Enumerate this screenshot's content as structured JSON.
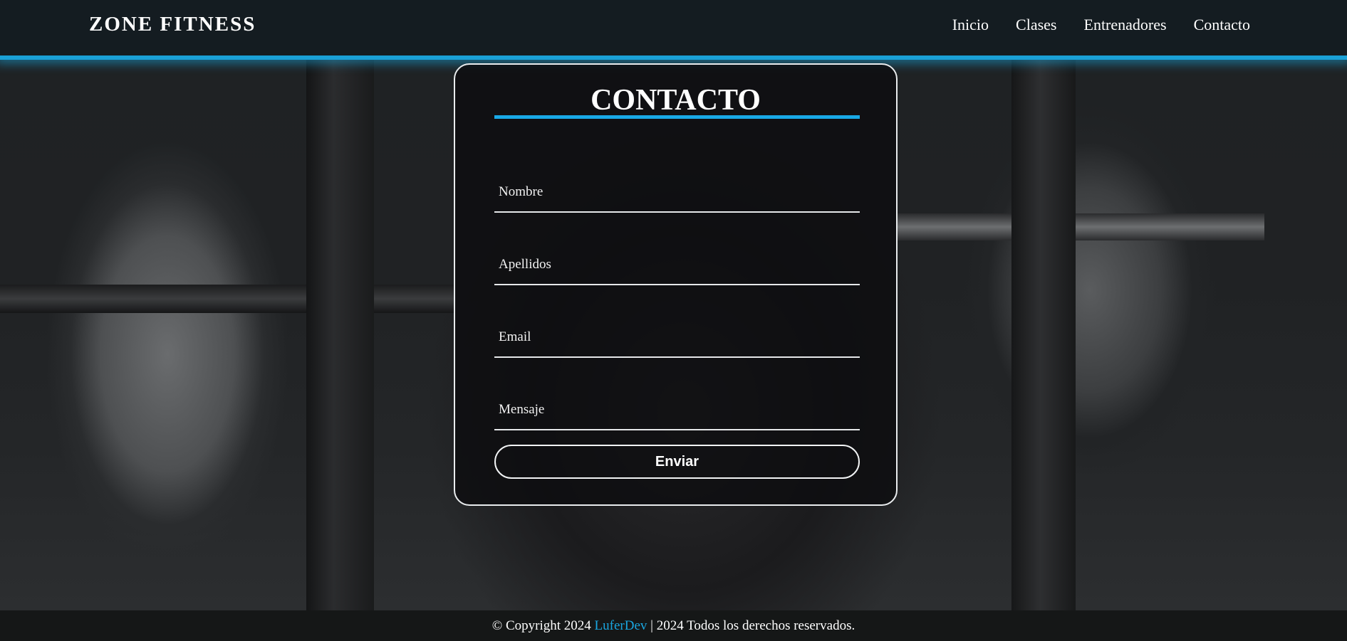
{
  "header": {
    "brand": "ZONE FITNESS",
    "nav": [
      "Inicio",
      "Clases",
      "Entrenadores",
      "Contacto"
    ]
  },
  "contact": {
    "title": "CONTACTO",
    "fields": {
      "nombre_placeholder": "Nombre",
      "apellidos_placeholder": "Apellidos",
      "email_placeholder": "Email",
      "mensaje_placeholder": "Mensaje",
      "nombre_value": "",
      "apellidos_value": "",
      "email_value": "",
      "mensaje_value": ""
    },
    "submit_label": "Enviar"
  },
  "footer": {
    "prefix": "© Copyright 2024 ",
    "link": "LuferDev",
    "suffix": " | 2024 Todos los derechos reservados."
  },
  "colors": {
    "accent": "#19a9e6",
    "header_bg": "#141c21",
    "footer_bg": "#151717"
  }
}
